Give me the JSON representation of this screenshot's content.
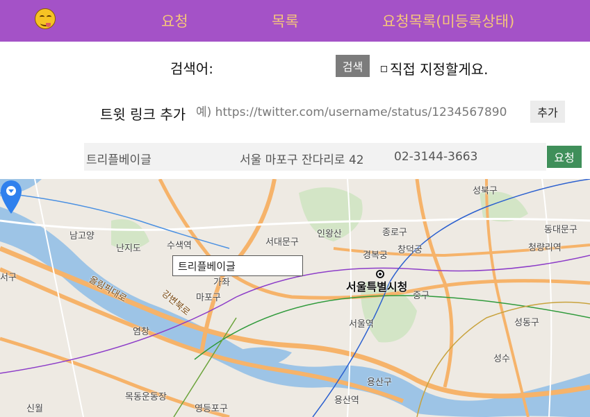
{
  "nav": {
    "logo_icon": "smiley-face-icon",
    "links": [
      "요청",
      "목록",
      "요청목록(미등록상태)"
    ]
  },
  "search": {
    "label": "검색어:",
    "input_value": "",
    "button_label": "검색",
    "direct_checkbox_label": "직접 지정할게요."
  },
  "tweet": {
    "label": "트윗 링크 추가",
    "placeholder": "예) https://twitter.com/username/status/1234567890",
    "add_button_label": "추가"
  },
  "result": {
    "name": "트리플베이글",
    "address": "서울 마포구 잔다리로 42",
    "phone": "02-3144-3663",
    "request_button_label": "요청"
  },
  "map": {
    "infowindow_text": "트리플베이글",
    "marker_icon": "map-marker-icon",
    "labels": [
      "성북구",
      "종로구",
      "동대문구",
      "서대문구",
      "인왕산",
      "창덕궁",
      "경복궁",
      "청량리역",
      "남고양",
      "수색역",
      "난지도",
      "서울특별시청",
      "서울역",
      "중구",
      "성동구",
      "마포구",
      "강변북로",
      "올림픽대로",
      "염창",
      "목동운동장",
      "용산구",
      "용산역",
      "영등포구",
      "성수",
      "신월",
      "서구",
      "가좌"
    ],
    "colors": {
      "land": "#eeeae3",
      "river": "#9dc4e6",
      "park": "#cfe3c1",
      "road": "#f6b36a"
    }
  }
}
